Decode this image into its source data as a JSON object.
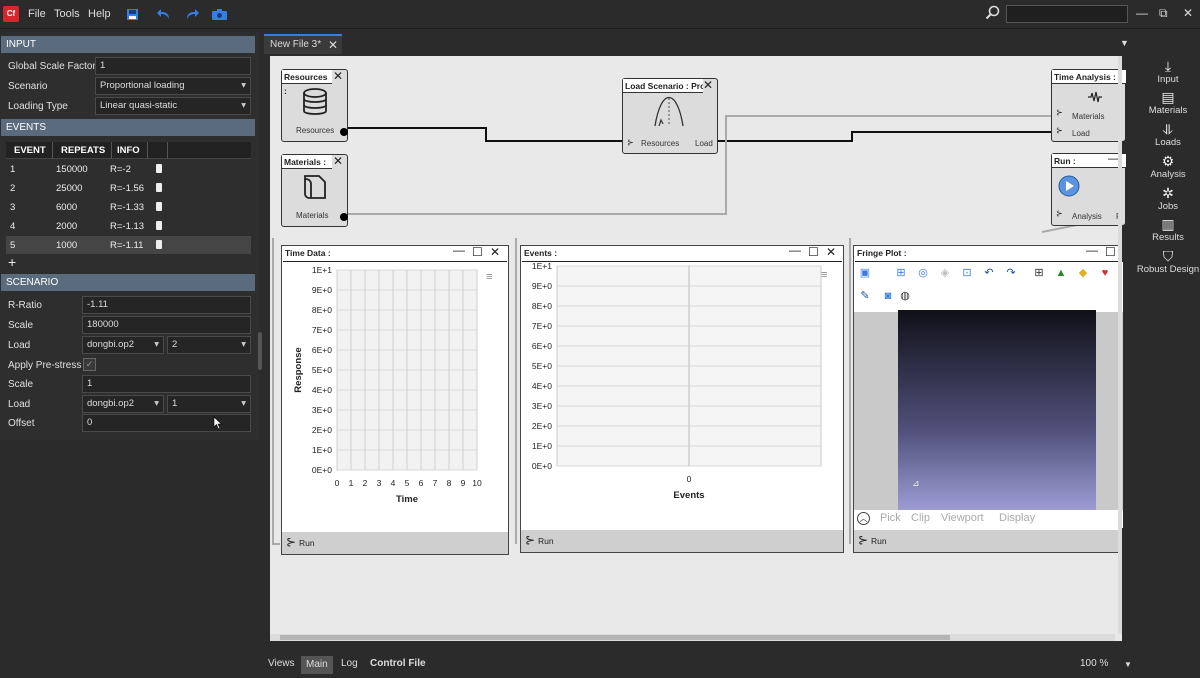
{
  "app": {
    "logo": "Cf",
    "menu": [
      "File",
      "Tools",
      "Help"
    ]
  },
  "toolbar": {
    "icons": [
      "save-icon",
      "undo-icon",
      "redo-icon",
      "camera-icon"
    ]
  },
  "window_controls": {
    "minimize": "—",
    "restore": "⧉",
    "close": "✕"
  },
  "input": {
    "header": "INPUT",
    "global_scale_factor": {
      "label": "Global Scale Factor",
      "value": "1"
    },
    "scenario": {
      "label": "Scenario",
      "value": "Proportional loading"
    },
    "loading_type": {
      "label": "Loading Type",
      "value": "Linear quasi-static"
    }
  },
  "events": {
    "header": "EVENTS",
    "columns": [
      "EVENT",
      "REPEATS",
      "INFO"
    ],
    "rows": [
      {
        "event": "1",
        "repeats": "150000",
        "info": "R=-2"
      },
      {
        "event": "2",
        "repeats": "25000",
        "info": "R=-1.56"
      },
      {
        "event": "3",
        "repeats": "6000",
        "info": "R=-1.33"
      },
      {
        "event": "4",
        "repeats": "2000",
        "info": "R=-1.13"
      },
      {
        "event": "5",
        "repeats": "1000",
        "info": "R=-1.11"
      }
    ],
    "add_label": "+"
  },
  "scenario": {
    "header": "SCENARIO",
    "r_ratio": {
      "label": "R-Ratio",
      "value": "-1.11"
    },
    "scale": {
      "label": "Scale",
      "value": "180000"
    },
    "load": {
      "label": "Load",
      "file": "dongbi.op2",
      "index": "2"
    },
    "apply_prestress": {
      "label": "Apply Pre-stress",
      "checked": true
    },
    "pre_scale": {
      "label": "Scale",
      "value": "1"
    },
    "pre_load": {
      "label": "Load",
      "file": "dongbi.op2",
      "index": "1"
    },
    "offset": {
      "label": "Offset",
      "value": "0"
    }
  },
  "tab": {
    "label": "New File 3*",
    "close": "✕"
  },
  "nodes": {
    "resources": {
      "title": "Resources :",
      "port": "Resources"
    },
    "materials": {
      "title": "Materials :",
      "port": "Materials"
    },
    "load_scenario": {
      "title": "Load Scenario : Prop",
      "in_port": "Resources",
      "out_port": "Load"
    },
    "time_analysis": {
      "title": "Time Analysis :",
      "port1": "Materials",
      "port2": "Load"
    },
    "run": {
      "title": "Run :",
      "port": "Analysis",
      "port2": "R"
    }
  },
  "time_data": {
    "title": "Time Data :",
    "foot": "Run"
  },
  "events_panel": {
    "title": "Events :",
    "foot": "Run"
  },
  "fringe": {
    "title": "Fringe Plot :",
    "tools": [
      "Pick",
      "Clip",
      "Viewport",
      "Display"
    ],
    "foot": "Run"
  },
  "chart_data": [
    {
      "type": "line",
      "title": "",
      "xlabel": "Time",
      "ylabel": "Response",
      "x_ticks": [
        "0",
        "1",
        "2",
        "3",
        "4",
        "5",
        "6",
        "7",
        "8",
        "9",
        "10"
      ],
      "y_ticks": [
        "1E+1",
        "9E+0",
        "8E+0",
        "7E+0",
        "6E+0",
        "5E+0",
        "4E+0",
        "3E+0",
        "2E+0",
        "1E+0",
        "0E+0"
      ],
      "xlim": [
        0,
        10
      ],
      "ylim": [
        0,
        10
      ],
      "grid": true,
      "series": []
    },
    {
      "type": "bar",
      "title": "",
      "xlabel": "Events",
      "ylabel": "",
      "x_ticks": [
        "0"
      ],
      "y_ticks": [
        "1E+1",
        "9E+0",
        "8E+0",
        "7E+0",
        "6E+0",
        "5E+0",
        "4E+0",
        "3E+0",
        "2E+0",
        "1E+0",
        "0E+0"
      ],
      "ylim": [
        0,
        10
      ],
      "grid": true,
      "series": []
    }
  ],
  "right_panel": [
    {
      "label": "Input",
      "icon": "input-icon"
    },
    {
      "label": "Materials",
      "icon": "materials-icon"
    },
    {
      "label": "Loads",
      "icon": "loads-icon"
    },
    {
      "label": "Analysis",
      "icon": "analysis-icon"
    },
    {
      "label": "Jobs",
      "icon": "jobs-icon"
    },
    {
      "label": "Results",
      "icon": "results-icon"
    },
    {
      "label": "Robust Design",
      "icon": "robust-design-icon"
    }
  ],
  "bottom_tabs": [
    "Views",
    "Main",
    "Log",
    "Control File"
  ],
  "zoom": "100 %"
}
